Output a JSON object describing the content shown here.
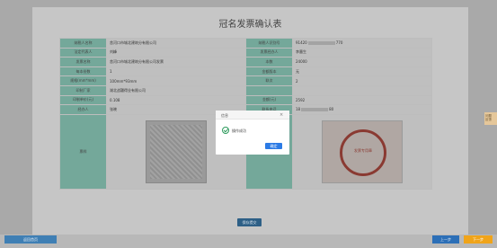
{
  "form": {
    "title": "冠名发票确认表",
    "rows": [
      {
        "l1": "纳税人名称",
        "v1": "舍河口市城北建筑分有限公司",
        "l2": "纳税人识别号",
        "v2a": "91420",
        "v2b": "770"
      },
      {
        "l1": "法定代表人",
        "v1": "刘峰",
        "l2": "发票经办人",
        "v2": "李墨生"
      },
      {
        "l1": "发票名称",
        "v1": "舍河口市城北建筑分有限公司发票",
        "l2": "本数",
        "v2": "24000"
      },
      {
        "l1": "每本份数",
        "v1": "1",
        "l2": "金额版本",
        "v2": "无"
      },
      {
        "l1": "规格(mm*mm)",
        "v1": "100mm*93mm",
        "l2": "联次",
        "v2": "2"
      },
      {
        "l1": "印制厂家",
        "v1": "湖北战疆得业有限公司"
      },
      {
        "l1": "印制单价(元)",
        "v1": "0.108",
        "l2": "金额(元)",
        "v2": "2592"
      },
      {
        "l1": "经办人",
        "v1": "张晓",
        "l2": "联系电话",
        "v2a": "18",
        "v2b": "80"
      }
    ],
    "sample_label": "票样",
    "seal_label": "发票专用章印模",
    "seal_text": "发票专用章",
    "save_button": "保存提交"
  },
  "modal": {
    "title": "信息",
    "close": "×",
    "message": "操作成功",
    "ok_button": "确定"
  },
  "footer": {
    "back_button": "返回首页",
    "prev_button": "上一步",
    "next_button": "下一步"
  },
  "side_help": {
    "line1": "问题",
    "line2": "反馈"
  }
}
